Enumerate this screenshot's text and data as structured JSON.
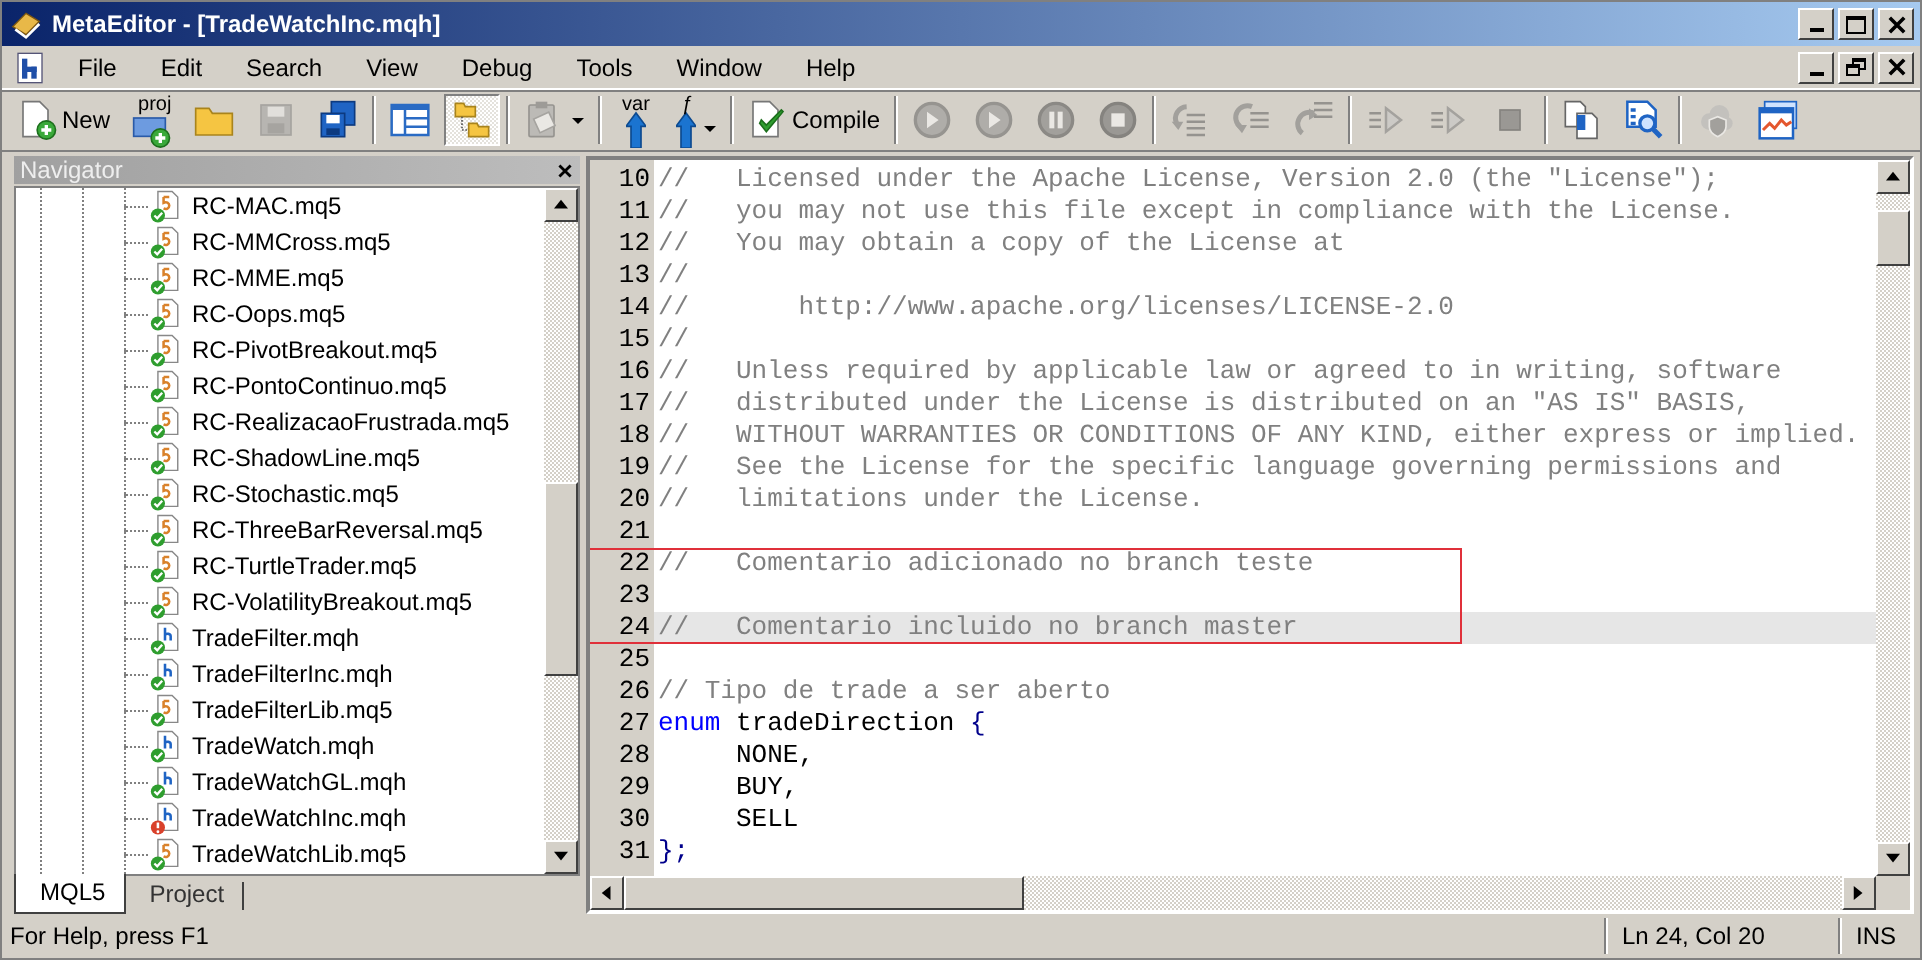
{
  "window": {
    "title": "MetaEditor - [TradeWatchInc.mqh]"
  },
  "menu": [
    "File",
    "Edit",
    "Search",
    "View",
    "Debug",
    "Tools",
    "Window",
    "Help"
  ],
  "toolbar": [
    [
      {
        "label": "New",
        "pressed": false,
        "disabled": false
      },
      {
        "badge": "proj",
        "pressed": false,
        "disabled": false
      },
      {
        "pressed": false,
        "disabled": false
      },
      {
        "pressed": false,
        "disabled": true
      },
      {
        "pressed": false,
        "disabled": false
      }
    ],
    [
      {
        "pressed": false,
        "disabled": false
      },
      {
        "pressed": true,
        "disabled": false
      }
    ],
    [
      {
        "pressed": false,
        "disabled": true,
        "dropdown": true
      }
    ],
    [
      {
        "badge": "var",
        "pressed": false,
        "disabled": false
      },
      {
        "badge": "ƒ",
        "pressed": false,
        "disabled": false,
        "dropdown": true
      }
    ],
    [
      {
        "label": "Compile",
        "pressed": false,
        "disabled": false
      }
    ],
    [
      {
        "pressed": false,
        "disabled": true
      },
      {
        "pressed": false,
        "disabled": true
      },
      {
        "pressed": false,
        "disabled": true
      },
      {
        "pressed": false,
        "disabled": true
      }
    ],
    [
      {
        "pressed": false,
        "disabled": true
      },
      {
        "pressed": false,
        "disabled": true
      },
      {
        "pressed": false,
        "disabled": true
      }
    ],
    [
      {
        "pressed": false,
        "disabled": true
      },
      {
        "pressed": false,
        "disabled": true
      },
      {
        "pressed": false,
        "disabled": true
      }
    ],
    [
      {
        "pressed": false,
        "disabled": false
      },
      {
        "pressed": false,
        "disabled": false
      }
    ],
    [
      {
        "pressed": false,
        "disabled": true
      },
      {
        "pressed": false,
        "disabled": false
      }
    ]
  ],
  "navigator": {
    "title": "Navigator",
    "items": [
      {
        "name": "RC-MAC.mq5",
        "kind": "source",
        "error": false
      },
      {
        "name": "RC-MMCross.mq5",
        "kind": "source",
        "error": false
      },
      {
        "name": "RC-MME.mq5",
        "kind": "source",
        "error": false
      },
      {
        "name": "RC-Oops.mq5",
        "kind": "source",
        "error": false
      },
      {
        "name": "RC-PivotBreakout.mq5",
        "kind": "source",
        "error": false
      },
      {
        "name": "RC-PontoContinuo.mq5",
        "kind": "source",
        "error": false
      },
      {
        "name": "RC-RealizacaoFrustrada.mq5",
        "kind": "source",
        "error": false
      },
      {
        "name": "RC-ShadowLine.mq5",
        "kind": "source",
        "error": false
      },
      {
        "name": "RC-Stochastic.mq5",
        "kind": "source",
        "error": false
      },
      {
        "name": "RC-ThreeBarReversal.mq5",
        "kind": "source",
        "error": false
      },
      {
        "name": "RC-TurtleTrader.mq5",
        "kind": "source",
        "error": false
      },
      {
        "name": "RC-VolatilityBreakout.mq5",
        "kind": "source",
        "error": false
      },
      {
        "name": "TradeFilter.mqh",
        "kind": "header",
        "error": false
      },
      {
        "name": "TradeFilterInc.mqh",
        "kind": "header",
        "error": false
      },
      {
        "name": "TradeFilterLib.mq5",
        "kind": "source",
        "error": false
      },
      {
        "name": "TradeWatch.mqh",
        "kind": "header",
        "error": false
      },
      {
        "name": "TradeWatchGL.mqh",
        "kind": "header",
        "error": false
      },
      {
        "name": "TradeWatchInc.mqh",
        "kind": "header",
        "error": true
      },
      {
        "name": "TradeWatchLib.mq5",
        "kind": "source",
        "error": false
      }
    ],
    "tabs": [
      {
        "label": "MQL5",
        "selected": true
      },
      {
        "label": "Project",
        "selected": false
      }
    ]
  },
  "editor": {
    "lines": [
      {
        "number": "10",
        "current": false,
        "marked": false,
        "tokens": [
          {
            "kind": "comment",
            "text": "//   Licensed under the Apache License, Version 2.0 (the \"License\");"
          }
        ]
      },
      {
        "number": "11",
        "current": false,
        "marked": false,
        "tokens": [
          {
            "kind": "comment",
            "text": "//   you may not use this file except in compliance with the License."
          }
        ]
      },
      {
        "number": "12",
        "current": false,
        "marked": false,
        "tokens": [
          {
            "kind": "comment",
            "text": "//   You may obtain a copy of the License at"
          }
        ]
      },
      {
        "number": "13",
        "current": false,
        "marked": false,
        "tokens": [
          {
            "kind": "comment",
            "text": "//"
          }
        ]
      },
      {
        "number": "14",
        "current": false,
        "marked": false,
        "tokens": [
          {
            "kind": "comment",
            "text": "//       http://www.apache.org/licenses/LICENSE-2.0"
          }
        ]
      },
      {
        "number": "15",
        "current": false,
        "marked": false,
        "tokens": [
          {
            "kind": "comment",
            "text": "//"
          }
        ]
      },
      {
        "number": "16",
        "current": false,
        "marked": false,
        "tokens": [
          {
            "kind": "comment",
            "text": "//   Unless required by applicable law or agreed to in writing, software"
          }
        ]
      },
      {
        "number": "17",
        "current": false,
        "marked": false,
        "tokens": [
          {
            "kind": "comment",
            "text": "//   distributed under the License is distributed on an \"AS IS\" BASIS,"
          }
        ]
      },
      {
        "number": "18",
        "current": false,
        "marked": false,
        "tokens": [
          {
            "kind": "comment",
            "text": "//   WITHOUT WARRANTIES OR CONDITIONS OF ANY KIND, either express or implied."
          }
        ]
      },
      {
        "number": "19",
        "current": false,
        "marked": false,
        "tokens": [
          {
            "kind": "comment",
            "text": "//   See the License for the specific language governing permissions and"
          }
        ]
      },
      {
        "number": "20",
        "current": false,
        "marked": false,
        "tokens": [
          {
            "kind": "comment",
            "text": "//   limitations under the License."
          }
        ]
      },
      {
        "number": "21",
        "current": false,
        "marked": false
      },
      {
        "number": "22",
        "current": false,
        "marked": true,
        "tokens": [
          {
            "kind": "comment",
            "text": "//   Comentario adicionado no branch teste"
          }
        ]
      },
      {
        "number": "23",
        "current": false,
        "marked": true
      },
      {
        "number": "24",
        "current": true,
        "marked": true,
        "tokens": [
          {
            "kind": "comment",
            "text": "//   Comentario incluido no branch master"
          }
        ]
      },
      {
        "number": "25",
        "current": false,
        "marked": false
      },
      {
        "number": "26",
        "current": false,
        "marked": false,
        "tokens": [
          {
            "kind": "comment",
            "text": "// Tipo de trade a ser aberto"
          }
        ]
      },
      {
        "number": "27",
        "current": false,
        "marked": false,
        "tokens": [
          {
            "kind": "keyword",
            "text": "enum"
          },
          {
            "kind": "plain",
            "text": " tradeDirection "
          },
          {
            "kind": "operator",
            "text": "{"
          }
        ]
      },
      {
        "number": "28",
        "current": false,
        "marked": false,
        "tokens": [
          {
            "kind": "plain",
            "text": "     NONE,"
          }
        ]
      },
      {
        "number": "29",
        "current": false,
        "marked": false,
        "tokens": [
          {
            "kind": "plain",
            "text": "     BUY,"
          }
        ]
      },
      {
        "number": "30",
        "current": false,
        "marked": false,
        "tokens": [
          {
            "kind": "plain",
            "text": "     SELL"
          }
        ]
      },
      {
        "number": "31",
        "current": false,
        "marked": false,
        "tokens": [
          {
            "kind": "operator",
            "text": "};"
          }
        ]
      }
    ]
  },
  "status_bar": {
    "help": "For Help, press F1",
    "position": "Ln 24, Col 20",
    "mode": "INS"
  }
}
